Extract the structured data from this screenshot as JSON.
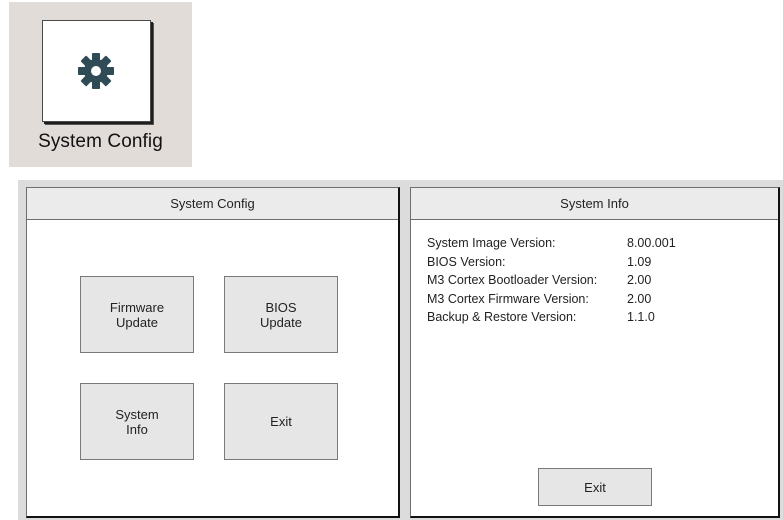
{
  "app_tile": {
    "label": "System Config",
    "icon": "gear-icon"
  },
  "config_panel": {
    "title": "System Config",
    "buttons": {
      "firmware": "Firmware\nUpdate",
      "bios": "BIOS\nUpdate",
      "system_info": "System\nInfo",
      "exit": "Exit"
    }
  },
  "info_panel": {
    "title": "System Info",
    "rows": [
      {
        "label": "System Image Version:",
        "value": "8.00.001"
      },
      {
        "label": "BIOS Version:",
        "value": "1.09"
      },
      {
        "label": "M3 Cortex Bootloader Version:",
        "value": "2.00"
      },
      {
        "label": "M3 Cortex Firmware Version:",
        "value": "2.00"
      },
      {
        "label": "Backup & Restore Version:",
        "value": "1.1.0"
      }
    ],
    "exit_label": "Exit"
  },
  "colors": {
    "tile_background": "#e2dcd9",
    "gear": "#2f4b55",
    "button_face": "#e6e6e6",
    "header_face": "#ebebeb"
  }
}
